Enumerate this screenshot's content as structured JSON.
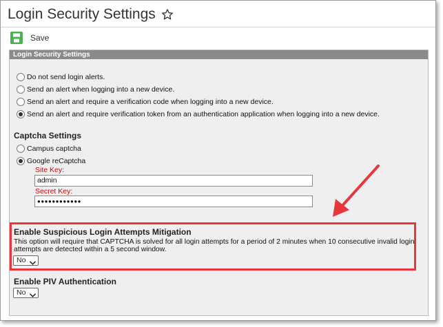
{
  "page": {
    "title": "Login Security Settings"
  },
  "toolbar": {
    "save_label": "Save"
  },
  "panel": {
    "header": "Login Security Settings",
    "login_alerts": [
      {
        "label": "Do not send login alerts.",
        "checked": false
      },
      {
        "label": "Send an alert when logging into a new device.",
        "checked": false
      },
      {
        "label": "Send an alert and require a verification code when logging into a new device.",
        "checked": false
      },
      {
        "label": "Send an alert and require verification token from an authentication application when logging into a new device.",
        "checked": true
      }
    ],
    "captcha": {
      "title": "Captcha Settings",
      "options": [
        {
          "label": "Campus captcha",
          "checked": false
        },
        {
          "label": "Google reCaptcha",
          "checked": true
        }
      ],
      "site_key_label": "Site Key:",
      "site_key_value": "admin",
      "secret_key_label": "Secret Key:",
      "secret_key_value": "●●●●●●●●●●●●"
    },
    "suspicious": {
      "title": "Enable Suspicious Login Attempts Mitigation",
      "description": "This option will require that CAPTCHA is solved for all login attempts for a period of 2 minutes when 10 consecutive invalid login attempts are detected within a 5 second window.",
      "selected": "No"
    },
    "piv": {
      "title": "Enable PIV Authentication",
      "selected": "No"
    }
  },
  "colors": {
    "highlight": "#e8363f",
    "required_label": "#d40000",
    "header_bg": "#8a8a8a",
    "save_icon": "#4caf50"
  },
  "icons": {
    "favorite": "star-icon",
    "save": "save-icon",
    "dropdown": "chevron-down-icon"
  }
}
